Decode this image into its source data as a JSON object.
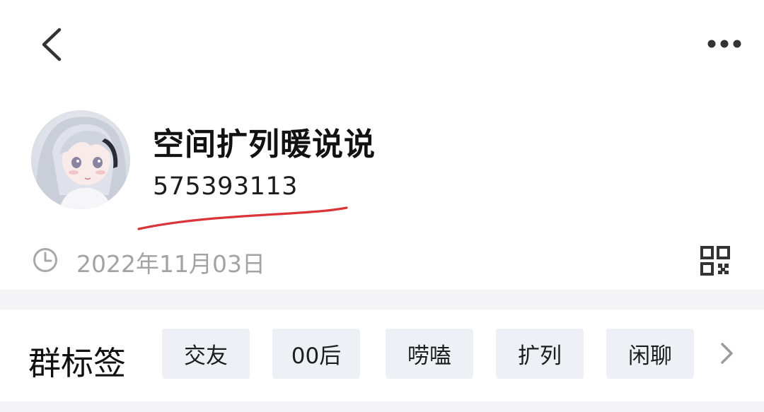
{
  "header": {
    "back_icon": "chevron-left-icon",
    "more_icon": "more-horizontal-icon"
  },
  "profile": {
    "group_name": "空间扩列暖说说",
    "group_number": "575393113",
    "created_date": "2022年11月03日",
    "clock_icon": "clock-icon",
    "qr_icon": "qr-code-icon",
    "underline_color": "#d9343a"
  },
  "tags": {
    "title": "群标签",
    "items": [
      "交友",
      "00后",
      "唠嗑",
      "扩列",
      "闲聊"
    ],
    "more_icon": "chevron-right-icon"
  },
  "colors": {
    "chip_bg": "#eef0f6",
    "muted_text": "#a3a3a3",
    "divider": "#f4f4f6"
  }
}
